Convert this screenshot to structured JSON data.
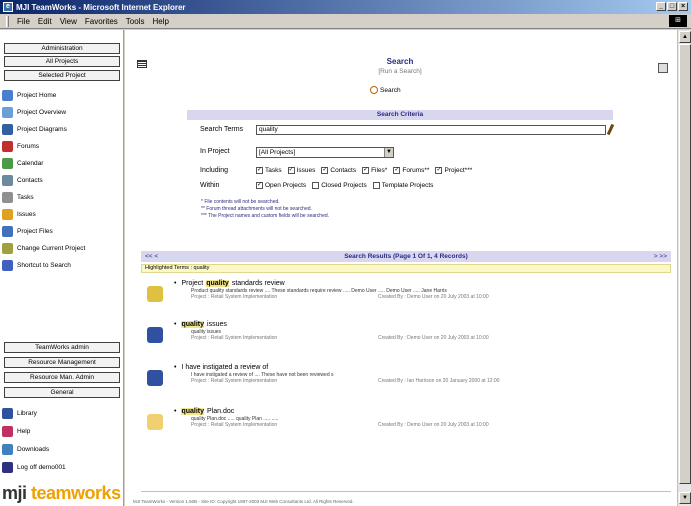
{
  "window": {
    "title": "MJI TeamWorks - Microsoft Internet Explorer",
    "controls": [
      "_",
      "□",
      "×"
    ]
  },
  "menu": [
    "File",
    "Edit",
    "View",
    "Favorites",
    "Tools",
    "Help"
  ],
  "sidebar": {
    "top_buttons": [
      "Administration",
      "All Projects",
      "Selected Project"
    ],
    "links": [
      {
        "label": "Project Home",
        "icon": "house-icon",
        "color": "#4a7fd0"
      },
      {
        "label": "Project Overview",
        "icon": "overview-icon",
        "color": "#6a9fd8"
      },
      {
        "label": "Project Diagrams",
        "icon": "diagram-icon",
        "color": "#3060a0"
      },
      {
        "label": "Forums",
        "icon": "forum-icon",
        "color": "#c03030"
      },
      {
        "label": "Calendar",
        "icon": "calendar-icon",
        "color": "#4a9a4a"
      },
      {
        "label": "Contacts",
        "icon": "contacts-icon",
        "color": "#6a8aa0"
      },
      {
        "label": "Tasks",
        "icon": "tasks-icon",
        "color": "#909090"
      },
      {
        "label": "Issues",
        "icon": "issues-icon",
        "color": "#e0a020"
      },
      {
        "label": "Project Files",
        "icon": "files-icon",
        "color": "#4070c0"
      },
      {
        "label": "Change Current Project",
        "icon": "change-project-icon",
        "color": "#a0a040"
      },
      {
        "label": "Shortcut to Search",
        "icon": "search-shortcut-icon",
        "color": "#4060c0"
      }
    ],
    "bottom_buttons": [
      "TeamWorks admin",
      "Resource Management",
      "Resource Man. Admin",
      "General"
    ],
    "bottom_links": [
      {
        "label": "Library",
        "icon": "library-icon",
        "color": "#3050a0"
      },
      {
        "label": "Help",
        "icon": "help-icon",
        "color": "#c03060"
      },
      {
        "label": "Downloads",
        "icon": "downloads-icon",
        "color": "#4080c0"
      },
      {
        "label": "Log off demo001",
        "icon": "logoff-icon",
        "color": "#303080"
      }
    ],
    "logo": {
      "mji": "mji",
      "tw": "teamworks"
    }
  },
  "main": {
    "title": "Search",
    "subtitle": "[Run a Search]",
    "search_link": "Search",
    "criteria": {
      "header": "Search Criteria",
      "search_terms_label": "Search Terms",
      "search_terms_value": "quality",
      "in_project_label": "In Project",
      "in_project_value": "[All Projects]",
      "including_label": "Including",
      "including_options": [
        {
          "label": "Tasks",
          "checked": true
        },
        {
          "label": "Issues",
          "checked": true
        },
        {
          "label": "Contacts",
          "checked": true
        },
        {
          "label": "Files*",
          "checked": true
        },
        {
          "label": "Forums**",
          "checked": true
        },
        {
          "label": "Project***",
          "checked": true
        }
      ],
      "within_label": "Within",
      "within_options": [
        {
          "label": "Open Projects",
          "checked": true
        },
        {
          "label": "Closed Projects",
          "checked": false
        },
        {
          "label": "Template Projects",
          "checked": false
        }
      ],
      "notes": [
        "* File contents will not be searched.",
        "** Forum thread attachments will not be searched.",
        "*** The Project names and custom fields will be searched."
      ]
    },
    "results": {
      "nav_left": "<< <",
      "header": "Search Results (Page 1 Of 1, 4 Records)",
      "nav_right": "> >>",
      "highlighted_terms": "Highlighted Terms : quality",
      "items": [
        {
          "icon": "task-icon",
          "title_pre": "Project",
          "title_hl": "quality",
          "title_post": "standards review",
          "excerpt": "Product quality standards review .... These standards require review ..... Demo User ..... Demo User ..... Jane Harris",
          "meta": "Project : Retail System Implementation",
          "created": "Created By : Demo User on 20 July 2003 at 10:00"
        },
        {
          "icon": "issue-people-icon",
          "title_pre": "",
          "title_hl": "quality",
          "title_post": "issues",
          "excerpt": "quality issues",
          "meta": "Project : Retail System Implementation",
          "created": "Created By : Demo User on 20 July 2003 at 10:00"
        },
        {
          "icon": "forum-people-icon",
          "title_pre": "I have instigated a review of",
          "title_hl": "",
          "title_post": "",
          "excerpt": "I have instigated a review of .... These have not been reviewed s",
          "meta": "Project : Retail System Implementation",
          "created": "Created By : Ian Harrison on 20 January 2000 at 12:00"
        },
        {
          "icon": "folder-file-icon",
          "title_pre": "",
          "title_hl": "quality",
          "title_post": "Plan.doc",
          "excerpt": "quality Plan.doc ..... quality Plan ..... .....",
          "meta": "Project : Retail System Implementation",
          "created": "Created By : Demo User on 20 July 2003 at 10:00"
        }
      ]
    },
    "footer": "MJI TeamWorks - Version 1.50B - Site ID: Copyright 1997-2003 MJI Web Consultants Ltd. All Rights Reserved."
  }
}
